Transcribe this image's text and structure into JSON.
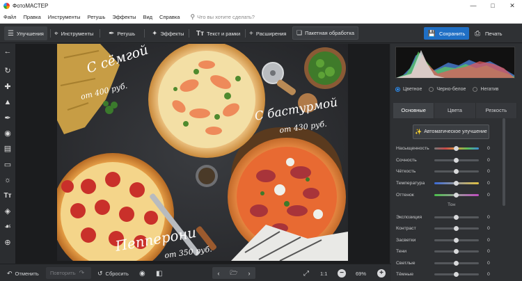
{
  "app": {
    "title": "ФотоМАСТЕР"
  },
  "menu": {
    "items": [
      "Файл",
      "Правка",
      "Инструменты",
      "Ретушь",
      "Эффекты",
      "Вид",
      "Справка"
    ],
    "search_placeholder": "Что вы хотите сделать?"
  },
  "toolbar": {
    "tabs": [
      {
        "label": "Улучшения",
        "icon": "sliders-icon",
        "active": true
      },
      {
        "label": "Инструменты",
        "icon": "crop-icon",
        "active": false
      },
      {
        "label": "Ретушь",
        "icon": "brush-icon",
        "active": false
      },
      {
        "label": "Эффекты",
        "icon": "magic-wand-icon",
        "active": false
      },
      {
        "label": "Текст и рамки",
        "icon": "text-icon",
        "active": false
      },
      {
        "label": "Расширения",
        "icon": "plus-icon",
        "active": false
      }
    ],
    "batch_label": "Пакетная обработка",
    "save_label": "Сохранить",
    "print_label": "Печать"
  },
  "left_tools": [
    "back-arrow-icon",
    "rotate-icon",
    "bandage-icon",
    "stamp-icon",
    "brush-icon",
    "radial-filter-icon",
    "gradient-filter-icon",
    "vignette-icon",
    "sun-icon",
    "text-icon",
    "fill-icon",
    "drop-icon",
    "target-icon"
  ],
  "photo": {
    "captions": [
      {
        "main": "С сёмгой",
        "price": "от 400 руб."
      },
      {
        "main": "С бастурмой",
        "price": "от 430 руб."
      },
      {
        "main": "Пепперони",
        "price": "от 350 руб."
      }
    ]
  },
  "right_panel": {
    "color_modes": [
      {
        "label": "Цветное",
        "selected": true
      },
      {
        "label": "Черно-белое",
        "selected": false
      },
      {
        "label": "Негатив",
        "selected": false
      }
    ],
    "tabs": [
      {
        "label": "Основные",
        "active": true
      },
      {
        "label": "Цвета",
        "active": false
      },
      {
        "label": "Резкость",
        "active": false
      }
    ],
    "auto_button": "Автоматическое улучшение",
    "sliders_top": [
      {
        "label": "Насыщенность",
        "value": "0",
        "track": "sat"
      },
      {
        "label": "Сочность",
        "value": "0",
        "track": "plain"
      },
      {
        "label": "Чёткость",
        "value": "0",
        "track": "plain"
      },
      {
        "label": "Температура",
        "value": "0",
        "track": "temp"
      },
      {
        "label": "Оттенок",
        "value": "0",
        "track": "tint"
      }
    ],
    "tone_label": "Тон",
    "sliders_tone": [
      {
        "label": "Экспозиция",
        "value": "0"
      },
      {
        "label": "Контраст",
        "value": "0"
      },
      {
        "label": "Засветки",
        "value": "0"
      },
      {
        "label": "Тени",
        "value": "0"
      },
      {
        "label": "Светлые",
        "value": "0"
      },
      {
        "label": "Тёмные",
        "value": "0"
      }
    ]
  },
  "bottom": {
    "undo_label": "Отменить",
    "redo_label": "Повторить",
    "reset_label": "Сбросить",
    "zoom_1to1": "1:1",
    "zoom_value": "69%"
  },
  "colors": {
    "accent": "#1f6fc5",
    "background": "#2b2d30"
  }
}
